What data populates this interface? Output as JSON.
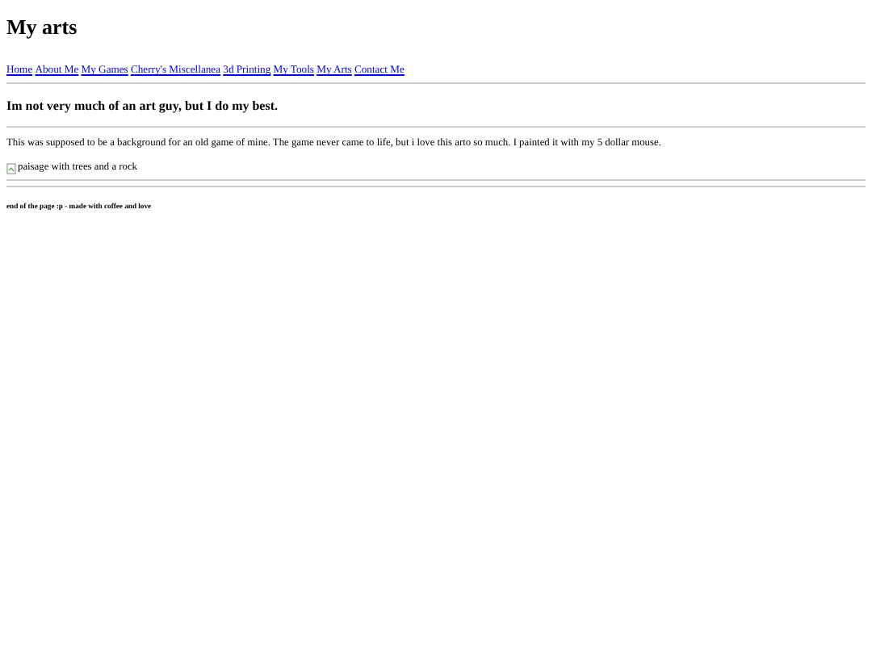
{
  "title": "My arts",
  "nav": [
    "Home",
    "About Me",
    "My Games",
    "Cherry's Miscellanea",
    "3d Printing",
    "My Tools",
    "My Arts",
    "Contact Me"
  ],
  "heading": "Im not very much of an art guy, but I do my best.",
  "paragraph": "This was supposed to be a background for an old game of mine. The game never came to life, but i love this arto so much. I painted it with my 5 dollar mouse.",
  "image_alt": "paisage with trees and a rock",
  "footer": "end of the page :p - made with coffee and love"
}
